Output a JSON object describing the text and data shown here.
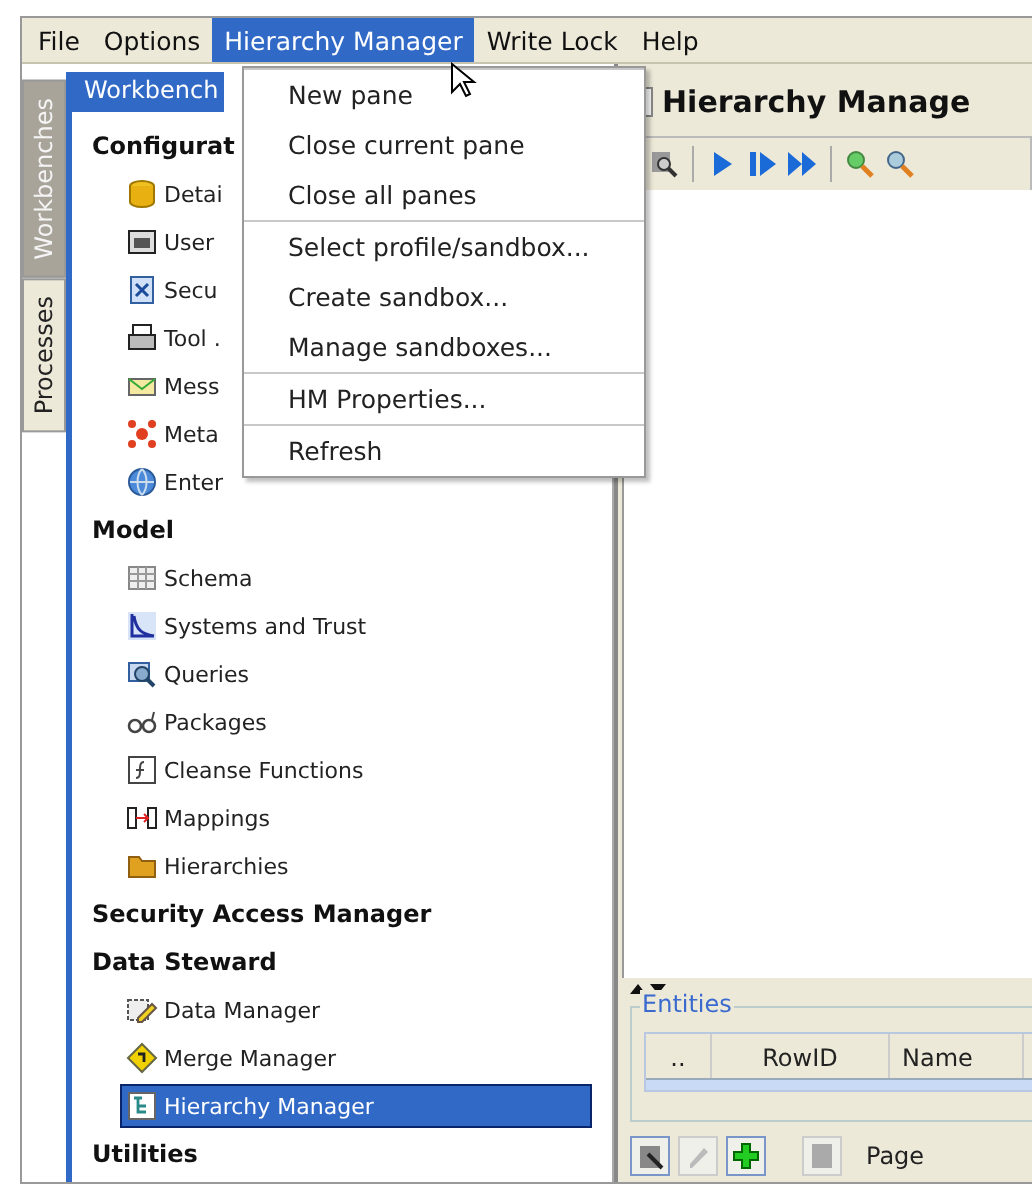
{
  "menu_bar": [
    {
      "label": "File",
      "selected": false
    },
    {
      "label": "Options",
      "selected": false
    },
    {
      "label": "Hierarchy Manager",
      "selected": true
    },
    {
      "label": "Write Lock",
      "selected": false
    },
    {
      "label": "Help",
      "selected": false
    }
  ],
  "open_menu": {
    "groups": [
      [
        "New pane",
        "Close current pane",
        "Close all panes"
      ],
      [
        "Select profile/sandbox...",
        "Create sandbox...",
        "Manage sandboxes..."
      ],
      [
        "HM Properties..."
      ],
      [
        "Refresh"
      ]
    ]
  },
  "side_tabs": [
    {
      "label": "Workbenches",
      "selected": true
    },
    {
      "label": "Processes",
      "selected": false
    }
  ],
  "workbench": {
    "title": "Workbench",
    "tree": [
      {
        "label": "Configurat",
        "selected": false,
        "children": [
          {
            "label": "Detai",
            "selected": false
          },
          {
            "label": "User",
            "selected": false
          },
          {
            "label": "Secu",
            "selected": false
          },
          {
            "label": "Tool .",
            "selected": false
          },
          {
            "label": "Mess",
            "selected": false
          },
          {
            "label": "Meta",
            "selected": false
          },
          {
            "label": "Enter",
            "selected": false
          }
        ]
      },
      {
        "label": "Model",
        "selected": false,
        "children": [
          {
            "label": "Schema",
            "selected": false
          },
          {
            "label": "Systems and Trust",
            "selected": false
          },
          {
            "label": "Queries",
            "selected": false
          },
          {
            "label": "Packages",
            "selected": false
          },
          {
            "label": "Cleanse Functions",
            "selected": false
          },
          {
            "label": "Mappings",
            "selected": false
          },
          {
            "label": "Hierarchies",
            "selected": false
          }
        ]
      },
      {
        "label": "Security Access Manager",
        "selected": false
      },
      {
        "label": "Data Steward",
        "selected": false,
        "children": [
          {
            "label": "Data Manager",
            "selected": false
          },
          {
            "label": "Merge Manager",
            "selected": false
          },
          {
            "label": "Hierarchy Manager",
            "selected": true
          }
        ]
      },
      {
        "label": "Utilities",
        "selected": false
      }
    ]
  },
  "pane": {
    "title": "Hierarchy Manage",
    "entities": {
      "title": "Entities",
      "columns": [
        "..",
        "RowID",
        "Name"
      ]
    },
    "pager_label": "Page"
  }
}
